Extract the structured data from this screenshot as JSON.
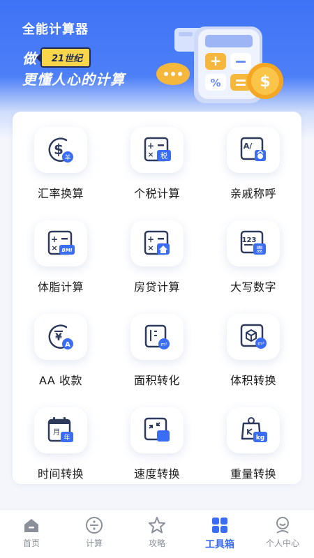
{
  "header": {
    "app_title": "全能计算器",
    "slogan_prefix": "做",
    "badge": "21世纪",
    "slogan_main": "更懂人心的计算"
  },
  "tools": [
    {
      "label": "汇率换算",
      "icon": "currency-exchange-icon"
    },
    {
      "label": "个税计算",
      "icon": "tax-calculator-icon"
    },
    {
      "label": "亲戚称呼",
      "icon": "relatives-icon"
    },
    {
      "label": "体脂计算",
      "icon": "bmi-calculator-icon"
    },
    {
      "label": "房贷计算",
      "icon": "mortgage-calculator-icon"
    },
    {
      "label": "大写数字",
      "icon": "capital-numbers-icon"
    },
    {
      "label": "AA 收款",
      "icon": "split-bill-icon"
    },
    {
      "label": "面积转化",
      "icon": "area-conversion-icon"
    },
    {
      "label": "体积转换",
      "icon": "volume-conversion-icon"
    },
    {
      "label": "时间转换",
      "icon": "time-conversion-icon"
    },
    {
      "label": "速度转换",
      "icon": "speed-conversion-icon"
    },
    {
      "label": "重量转换",
      "icon": "weight-conversion-icon"
    }
  ],
  "tool_icon_texts": {
    "tax": "税",
    "bmi": "BMI",
    "capital_digits": "123",
    "capital_char": "壹",
    "currency_char": "羊",
    "area_unit": "m²",
    "volume_unit": "m³",
    "time_month": "月",
    "time_year": "年",
    "weight_unit": "kg"
  },
  "tabbar": [
    {
      "label": "首页",
      "icon": "home-icon",
      "active": false
    },
    {
      "label": "计算",
      "icon": "divide-icon",
      "active": false
    },
    {
      "label": "攻略",
      "icon": "star-icon",
      "active": false
    },
    {
      "label": "工具箱",
      "icon": "toolbox-icon",
      "active": true
    },
    {
      "label": "个人中心",
      "icon": "profile-icon",
      "active": false
    }
  ],
  "colors": {
    "primary": "#3a6cf4",
    "icon_dark": "#2d3a5c",
    "badge_yellow": "#f7d64a"
  }
}
